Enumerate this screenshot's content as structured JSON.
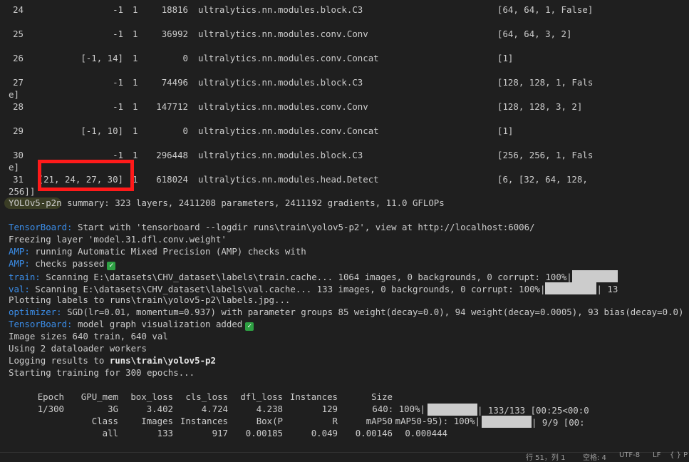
{
  "layers": [
    {
      "idx": "24",
      "from": "-1",
      "n": "1",
      "params": "18816",
      "module": "ultralytics.nn.modules.block.C3",
      "args": "[64, 64, 1, False]",
      "cont": ""
    },
    {
      "idx": "25",
      "from": "-1",
      "n": "1",
      "params": "36992",
      "module": "ultralytics.nn.modules.conv.Conv",
      "args": "[64, 64, 3, 2]",
      "cont": ""
    },
    {
      "idx": "26",
      "from": "[-1, 14]",
      "n": "1",
      "params": "0",
      "module": "ultralytics.nn.modules.conv.Concat",
      "args": "[1]",
      "cont": ""
    },
    {
      "idx": "27",
      "from": "-1",
      "n": "1",
      "params": "74496",
      "module": "ultralytics.nn.modules.block.C3",
      "args": "[128, 128, 1, Fals",
      "cont": "e]"
    },
    {
      "idx": "28",
      "from": "-1",
      "n": "1",
      "params": "147712",
      "module": "ultralytics.nn.modules.conv.Conv",
      "args": "[128, 128, 3, 2]",
      "cont": ""
    },
    {
      "idx": "29",
      "from": "[-1, 10]",
      "n": "1",
      "params": "0",
      "module": "ultralytics.nn.modules.conv.Concat",
      "args": "[1]",
      "cont": ""
    },
    {
      "idx": "30",
      "from": "-1",
      "n": "1",
      "params": "296448",
      "module": "ultralytics.nn.modules.block.C3",
      "args": "[256, 256, 1, Fals",
      "cont": "e]"
    },
    {
      "idx": "31",
      "from": "[21, 24, 27, 30]",
      "n": "1",
      "params": "618024",
      "module": "ultralytics.nn.modules.head.Detect",
      "args": "[6, [32, 64, 128,",
      "cont": "256]]"
    }
  ],
  "summary": {
    "model": "YOLOv5-p2n",
    "rest": " summary: 323 layers, 2411208 parameters, 2411192 gradients, 11.0 GFLOPs"
  },
  "log": {
    "tb_label": "TensorBoard:",
    "tb_text": " Start with 'tensorboard --logdir runs\\train\\yolov5-p2', view at http://localhost:6006/",
    "freezing": "Freezing layer 'model.31.dfl.conv.weight'",
    "amp_label": "AMP:",
    "amp1": " running Automatic Mixed Precision (AMP) checks with",
    "amp2": " checks passed",
    "train_label": "train:",
    "train_text": " Scanning E:\\datasets\\CHV_dataset\\labels\\train.cache... 1064 images, 0 backgrounds, 0 corrupt: 100%|",
    "val_label": "val:",
    "val_text": " Scanning E:\\datasets\\CHV_dataset\\labels\\val.cache... 133 images, 0 backgrounds, 0 corrupt: 100%|",
    "val_tail": "| 13",
    "plotting": "Plotting labels to runs\\train\\yolov5-p2\\labels.jpg...",
    "opt_label": "optimizer:",
    "opt_text": " SGD(lr=0.01, momentum=0.937) with parameter groups 85 weight(decay=0.0), 94 weight(decay=0.0005), 93 bias(decay=0.0)",
    "tb2_label": "TensorBoard:",
    "tb2_text": " model graph visualization added",
    "imgsz": "Image sizes 640 train, 640 val",
    "workers": "Using 2 dataloader workers",
    "logging_pre": "Logging results to ",
    "logging_path": "runs\\train\\yolov5-p2",
    "starting": "Starting training for 300 epochs..."
  },
  "train_table": {
    "headers": [
      "Epoch",
      "GPU_mem",
      "box_loss",
      "cls_loss",
      "dfl_loss",
      "Instances",
      "Size"
    ],
    "row": [
      "1/300",
      "3G",
      "3.402",
      "4.724",
      "4.238",
      "129",
      "640: 100%|"
    ],
    "row_tail": "| 133/133 [00:25<00:0"
  },
  "val_table": {
    "headers": [
      "Class",
      "Images",
      "Instances",
      "Box(P",
      "R",
      "mAP50",
      "mAP50-95): 100%|"
    ],
    "headers_tail": "| 9/9 [00:",
    "row": [
      "all",
      "133",
      "917",
      "0.00185",
      "0.049",
      "0.00146",
      "0.000444"
    ]
  },
  "status": {
    "pos": "行 51，列 1",
    "spaces": "空格: 4",
    "enc": "UTF-8",
    "eol": "LF",
    "lang": "{ } P"
  },
  "progress": {
    "train_scan": 1.0,
    "val_scan": 1.0,
    "epoch": 1.0,
    "val_batches": 1.0
  }
}
